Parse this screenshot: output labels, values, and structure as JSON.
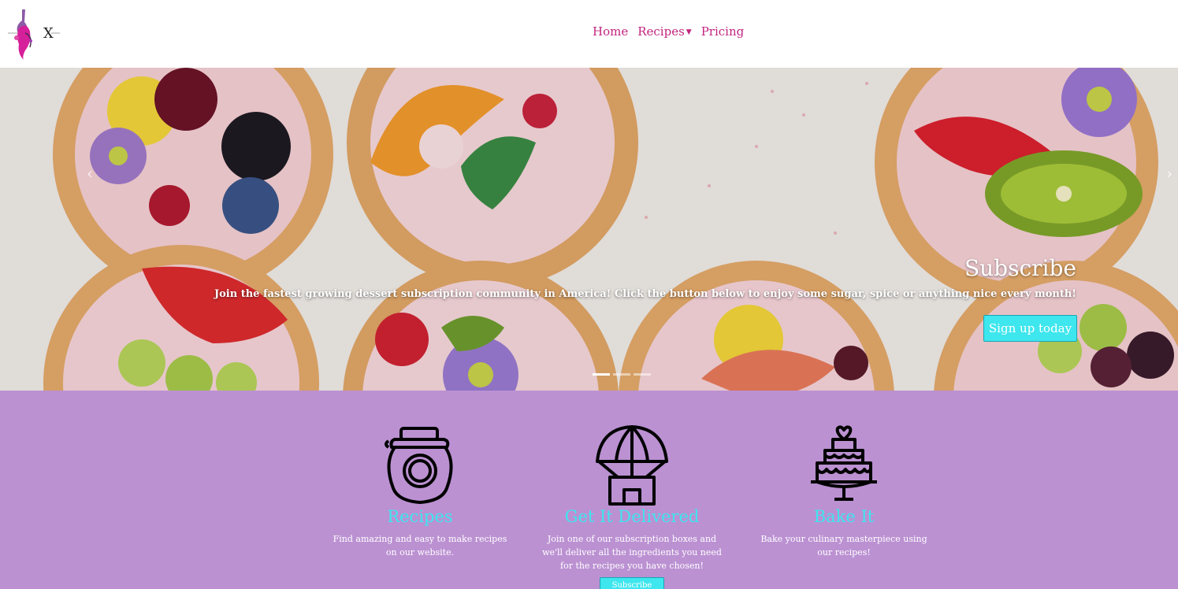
{
  "nav": {
    "logo_letter": "X",
    "links": [
      {
        "label": "Home"
      },
      {
        "label": "Recipes",
        "has_dropdown": true
      },
      {
        "label": "Pricing"
      }
    ]
  },
  "hero": {
    "title": "Subscribe",
    "text": "Join the fastest growing dessert subscription community in America! Click the button below to enjoy some sugar, spice or anything nice every month!",
    "button_label": "Sign up today",
    "prev_icon": "‹",
    "next_icon": "›",
    "slide_count": 3,
    "active_slide": 1
  },
  "features": [
    {
      "icon": "jar-icon",
      "title": "Recipes",
      "desc": "Find amazing and easy to make recipes on our website."
    },
    {
      "icon": "parachute-delivery-icon",
      "title": "Get It Delivered",
      "desc": "Join one of our subscription boxes and we'll deliver all the ingredients you need for the recipes you have chosen!"
    },
    {
      "icon": "cake-icon",
      "title": "Bake It",
      "desc": "Bake your culinary masterpiece using our recipes!"
    }
  ],
  "subscribe_button": "Subscribe",
  "colors": {
    "accent": "#3ee6ee",
    "nav_link": "#c2247f",
    "feature_bg": "#bb91d2"
  }
}
